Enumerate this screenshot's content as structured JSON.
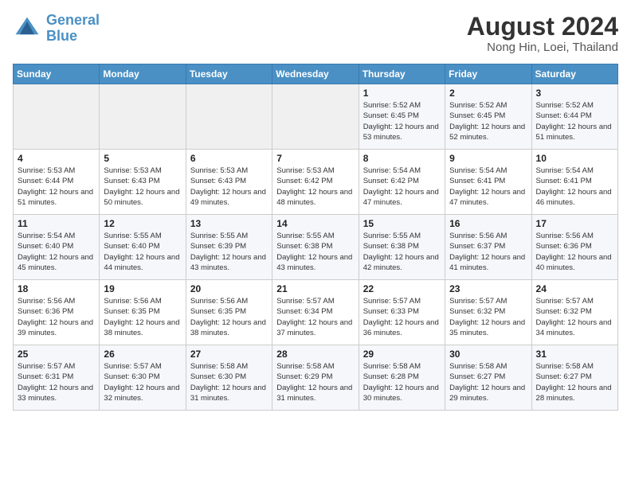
{
  "header": {
    "logo_line1": "General",
    "logo_line2": "Blue",
    "title": "August 2024",
    "subtitle": "Nong Hin, Loei, Thailand"
  },
  "weekdays": [
    "Sunday",
    "Monday",
    "Tuesday",
    "Wednesday",
    "Thursday",
    "Friday",
    "Saturday"
  ],
  "weeks": [
    [
      {
        "day": "",
        "info": ""
      },
      {
        "day": "",
        "info": ""
      },
      {
        "day": "",
        "info": ""
      },
      {
        "day": "",
        "info": ""
      },
      {
        "day": "1",
        "info": "Sunrise: 5:52 AM\nSunset: 6:45 PM\nDaylight: 12 hours and 53 minutes."
      },
      {
        "day": "2",
        "info": "Sunrise: 5:52 AM\nSunset: 6:45 PM\nDaylight: 12 hours and 52 minutes."
      },
      {
        "day": "3",
        "info": "Sunrise: 5:52 AM\nSunset: 6:44 PM\nDaylight: 12 hours and 51 minutes."
      }
    ],
    [
      {
        "day": "4",
        "info": "Sunrise: 5:53 AM\nSunset: 6:44 PM\nDaylight: 12 hours and 51 minutes."
      },
      {
        "day": "5",
        "info": "Sunrise: 5:53 AM\nSunset: 6:43 PM\nDaylight: 12 hours and 50 minutes."
      },
      {
        "day": "6",
        "info": "Sunrise: 5:53 AM\nSunset: 6:43 PM\nDaylight: 12 hours and 49 minutes."
      },
      {
        "day": "7",
        "info": "Sunrise: 5:53 AM\nSunset: 6:42 PM\nDaylight: 12 hours and 48 minutes."
      },
      {
        "day": "8",
        "info": "Sunrise: 5:54 AM\nSunset: 6:42 PM\nDaylight: 12 hours and 47 minutes."
      },
      {
        "day": "9",
        "info": "Sunrise: 5:54 AM\nSunset: 6:41 PM\nDaylight: 12 hours and 47 minutes."
      },
      {
        "day": "10",
        "info": "Sunrise: 5:54 AM\nSunset: 6:41 PM\nDaylight: 12 hours and 46 minutes."
      }
    ],
    [
      {
        "day": "11",
        "info": "Sunrise: 5:54 AM\nSunset: 6:40 PM\nDaylight: 12 hours and 45 minutes."
      },
      {
        "day": "12",
        "info": "Sunrise: 5:55 AM\nSunset: 6:40 PM\nDaylight: 12 hours and 44 minutes."
      },
      {
        "day": "13",
        "info": "Sunrise: 5:55 AM\nSunset: 6:39 PM\nDaylight: 12 hours and 43 minutes."
      },
      {
        "day": "14",
        "info": "Sunrise: 5:55 AM\nSunset: 6:38 PM\nDaylight: 12 hours and 43 minutes."
      },
      {
        "day": "15",
        "info": "Sunrise: 5:55 AM\nSunset: 6:38 PM\nDaylight: 12 hours and 42 minutes."
      },
      {
        "day": "16",
        "info": "Sunrise: 5:56 AM\nSunset: 6:37 PM\nDaylight: 12 hours and 41 minutes."
      },
      {
        "day": "17",
        "info": "Sunrise: 5:56 AM\nSunset: 6:36 PM\nDaylight: 12 hours and 40 minutes."
      }
    ],
    [
      {
        "day": "18",
        "info": "Sunrise: 5:56 AM\nSunset: 6:36 PM\nDaylight: 12 hours and 39 minutes."
      },
      {
        "day": "19",
        "info": "Sunrise: 5:56 AM\nSunset: 6:35 PM\nDaylight: 12 hours and 38 minutes."
      },
      {
        "day": "20",
        "info": "Sunrise: 5:56 AM\nSunset: 6:35 PM\nDaylight: 12 hours and 38 minutes."
      },
      {
        "day": "21",
        "info": "Sunrise: 5:57 AM\nSunset: 6:34 PM\nDaylight: 12 hours and 37 minutes."
      },
      {
        "day": "22",
        "info": "Sunrise: 5:57 AM\nSunset: 6:33 PM\nDaylight: 12 hours and 36 minutes."
      },
      {
        "day": "23",
        "info": "Sunrise: 5:57 AM\nSunset: 6:32 PM\nDaylight: 12 hours and 35 minutes."
      },
      {
        "day": "24",
        "info": "Sunrise: 5:57 AM\nSunset: 6:32 PM\nDaylight: 12 hours and 34 minutes."
      }
    ],
    [
      {
        "day": "25",
        "info": "Sunrise: 5:57 AM\nSunset: 6:31 PM\nDaylight: 12 hours and 33 minutes."
      },
      {
        "day": "26",
        "info": "Sunrise: 5:57 AM\nSunset: 6:30 PM\nDaylight: 12 hours and 32 minutes."
      },
      {
        "day": "27",
        "info": "Sunrise: 5:58 AM\nSunset: 6:30 PM\nDaylight: 12 hours and 31 minutes."
      },
      {
        "day": "28",
        "info": "Sunrise: 5:58 AM\nSunset: 6:29 PM\nDaylight: 12 hours and 31 minutes."
      },
      {
        "day": "29",
        "info": "Sunrise: 5:58 AM\nSunset: 6:28 PM\nDaylight: 12 hours and 30 minutes."
      },
      {
        "day": "30",
        "info": "Sunrise: 5:58 AM\nSunset: 6:27 PM\nDaylight: 12 hours and 29 minutes."
      },
      {
        "day": "31",
        "info": "Sunrise: 5:58 AM\nSunset: 6:27 PM\nDaylight: 12 hours and 28 minutes."
      }
    ]
  ]
}
